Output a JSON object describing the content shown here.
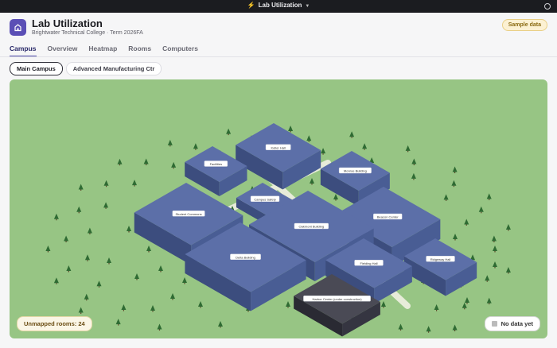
{
  "topbar": {
    "title": "Lab Utilization"
  },
  "header": {
    "title": "Lab Utilization",
    "subtitle": "Brightwater Technical College · Term 2026FA",
    "badge": "Sample data"
  },
  "tabs": [
    "Campus",
    "Overview",
    "Heatmap",
    "Rooms",
    "Computers"
  ],
  "active_tab": "Campus",
  "campus_pills": [
    "Main Campus",
    "Advanced Manufacturing Ctr"
  ],
  "active_campus": "Main Campus",
  "map": {
    "buildings": [
      "Keller Hall",
      "Facilities",
      "Monroe Building",
      "Campus Safety",
      "Student Commons",
      "Beacon Center",
      "Oakmont Building",
      "Delta Building",
      "Ridgeway Hall",
      "Fielding Hall",
      "Harbor Center (under construction)"
    ],
    "unmapped": "Unmapped rooms: 24",
    "legend": "No data yet"
  },
  "colors": {
    "accent": "#4b47a8",
    "grass": "#97c584",
    "building": "#4a5d96",
    "path": "#e7ecd9"
  }
}
